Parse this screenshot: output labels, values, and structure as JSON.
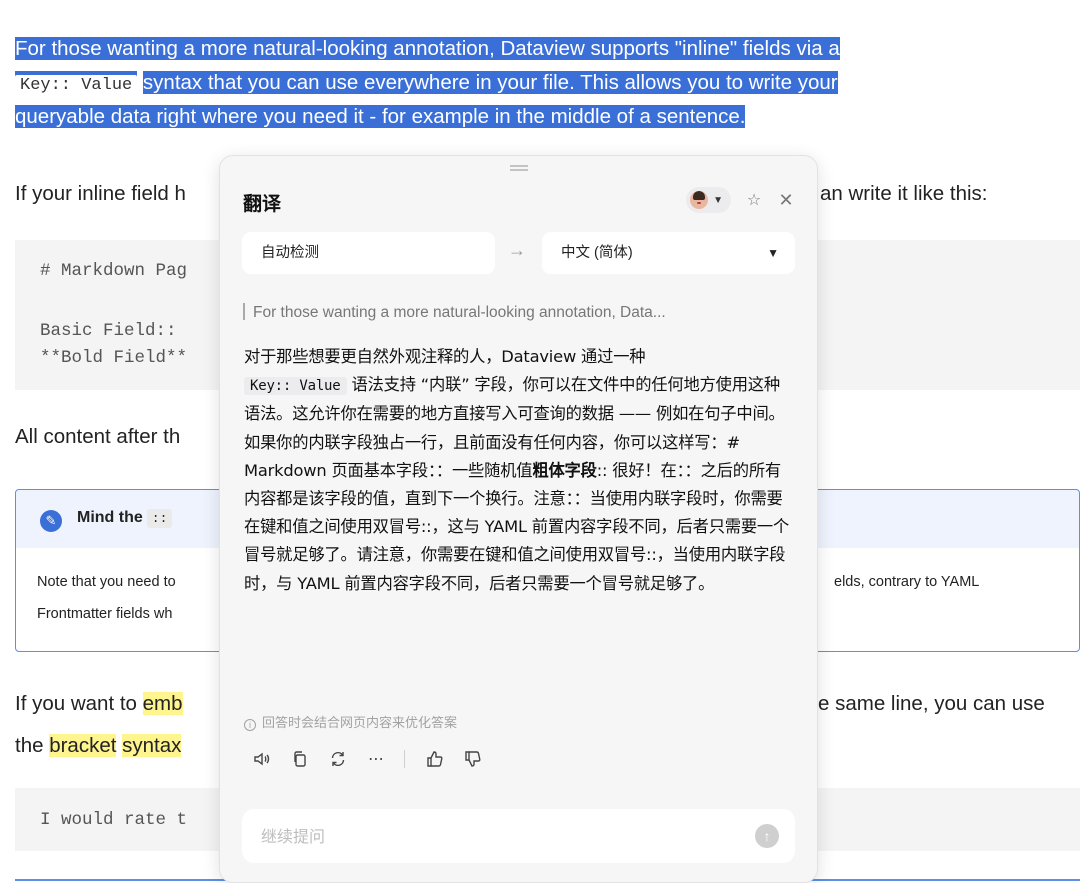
{
  "doc": {
    "para1": {
      "line1": "For those wanting a more natural-looking annotation, Dataview supports \"inline\" fields via a",
      "code": "Key:: Value",
      "line2_rest": "syntax that you can use everywhere in your file. This allows you to write your",
      "line3": "queryable data right where you need it - for example in the middle of a sentence."
    },
    "para2_left": "If your inline field h",
    "para2_right": "an write it like this:",
    "code1": {
      "line1": "# Markdown Pag",
      "line2": "Basic Field::",
      "line3": "**Bold Field**"
    },
    "para3_left": "All content after th",
    "callout": {
      "title": "Mind the",
      "title_code": "::",
      "body1_left": "Note that you need to",
      "body1_right": "elds, contrary to YAML",
      "body2_left": "Frontmatter fields wh"
    },
    "para4": {
      "l1_a": "If you want to ",
      "l1_hl": "emb",
      "l1_right": "e same line, you can use",
      "l2_a": "the ",
      "l2_hl1": "bracket",
      "l2_hl2": "syntax"
    },
    "code2_line": "I would rate t"
  },
  "popup": {
    "title": "翻译",
    "source_lang": "自动检测",
    "target_lang": "中文 (简体)",
    "source_text": "For those wanting a more natural-looking annotation, Data...",
    "translation": {
      "p1": "对于那些想要更自然外观注释的人，Dataview 通过一种",
      "code": "Key:: Value",
      "p2": " 语法支持 “内联” 字段，你可以在文件中的任何地方使用这种语法。这允许你在需要的地方直接写入可查询的数据 —— 例如在句子中间。如果你的内联字段独占一行，且前面没有任何内容，你可以这样写：# Markdown 页面基本字段：：一些随机值",
      "bold": "粗体字段",
      "p3": ":: 很好！在：：之后的所有内容都是该字段的值，直到下一个换行。注意：：当使用内联字段时，你需要在键和值之间使用双冒号::，这与 YAML 前置内容字段不同，后者只需要一个冒号就足够了。请注意，你需要在键和值之间使用双冒号::，当使用内联字段时，与 YAML 前置内容字段不同，后者只需要一个冒号就足够了。"
    },
    "note": "回答时会结合网页内容来优化答案",
    "followup_placeholder": "继续提问",
    "icons": {
      "avatar": "user-avatar-icon",
      "pin": "pin-icon",
      "close": "close-icon",
      "arrow": "arrow-right-icon",
      "actions": [
        "speaker-icon",
        "copy-icon",
        "refresh-icon",
        "more-icon",
        "thumbs-up-icon",
        "thumbs-down-icon"
      ],
      "send": "send-icon"
    }
  },
  "colors": {
    "selection": "#3a6fd8",
    "highlight": "#fff58f",
    "callout_border": "#5b8fe8"
  }
}
